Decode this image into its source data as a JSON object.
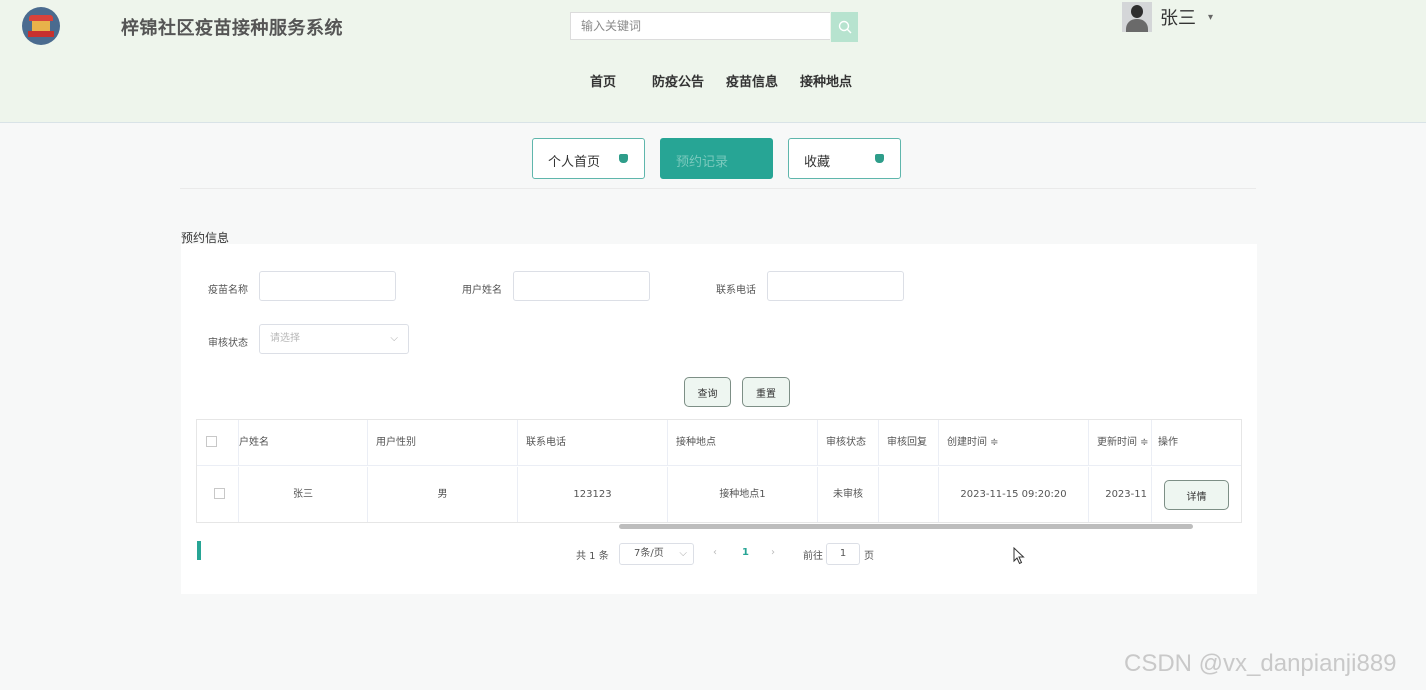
{
  "header": {
    "site_title": "梓锦社区疫苗接种服务系统",
    "search_placeholder": "输入关键词",
    "user_name": "张三",
    "caret": "▾",
    "nav": [
      "首页",
      "防疫公告",
      "疫苗信息",
      "接种地点"
    ]
  },
  "tabs": [
    {
      "label": "个人首页",
      "active": false
    },
    {
      "label": "预约记录",
      "active": true
    },
    {
      "label": "收藏",
      "active": false
    }
  ],
  "section_title": "预约信息",
  "filters": {
    "vaccine_name_label": "疫苗名称",
    "user_name_label": "用户姓名",
    "phone_label": "联系电话",
    "status_label": "审核状态",
    "status_placeholder": "请选择",
    "search_button": "查询",
    "reset_button": "重置"
  },
  "table": {
    "columns": [
      "户姓名",
      "用户性别",
      "联系电话",
      "接种地点",
      "审核状态",
      "审核回复",
      "创建时间 ≑",
      "更新时间 ≑",
      "操作"
    ],
    "rows": [
      {
        "name": "张三",
        "gender": "男",
        "phone": "123123",
        "location": "接种地点1",
        "status": "未审核",
        "reply": "",
        "created": "2023-11-15 09:20:20",
        "updated": "2023-11",
        "action": "详情"
      }
    ]
  },
  "pagination": {
    "total": "共 1 条",
    "page_size": "7条/页",
    "prev": "‹",
    "current": "1",
    "next": "›",
    "goto_label": "前往",
    "goto_value": "1",
    "page_suffix": "页"
  },
  "watermark": "CSDN @vx_danpianji889",
  "colors": {
    "accent": "#27a595",
    "header_bg": "#eef5ec"
  }
}
